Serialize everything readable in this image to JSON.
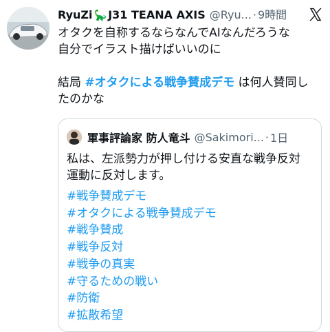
{
  "tweet": {
    "author": {
      "display_name": "RyuZi",
      "name_emoji": "🦕",
      "name_suffix": "J31 TEANA AXIS",
      "handle": "@Ryu...",
      "separator": "·",
      "time": "9時間"
    },
    "platform_icon": "x-logo-icon",
    "text_line1": "オタクを自称するならなんでAIなんだろうな",
    "text_line2": "自分でイラスト描けばいいのに",
    "text_line3_prefix": "結局 ",
    "text_line3_hashtag": "#オタクによる戦争賛成デモ",
    "text_line3_suffix": " は何人賛同し",
    "text_line4": "たのかな"
  },
  "quote": {
    "author": {
      "display_name": "軍事評論家 防人竜斗",
      "handle": "@Sakimori...",
      "separator": "·",
      "time": "1日"
    },
    "body_line1": "私は、左派勢力が押し付ける安直な戦争反対",
    "body_line2": "運動に反対します。",
    "hashtags": [
      "#戦争賛成デモ",
      "#オタクによる戦争賛成デモ",
      "#戦争賛成",
      "#戦争反対",
      "#戦争の真実",
      "#守るための戦い",
      "#防衛",
      "#拡散希望"
    ]
  },
  "colors": {
    "hashtag": "#1d9bf0",
    "secondary_text": "#536471",
    "border": "#cfd9de"
  }
}
